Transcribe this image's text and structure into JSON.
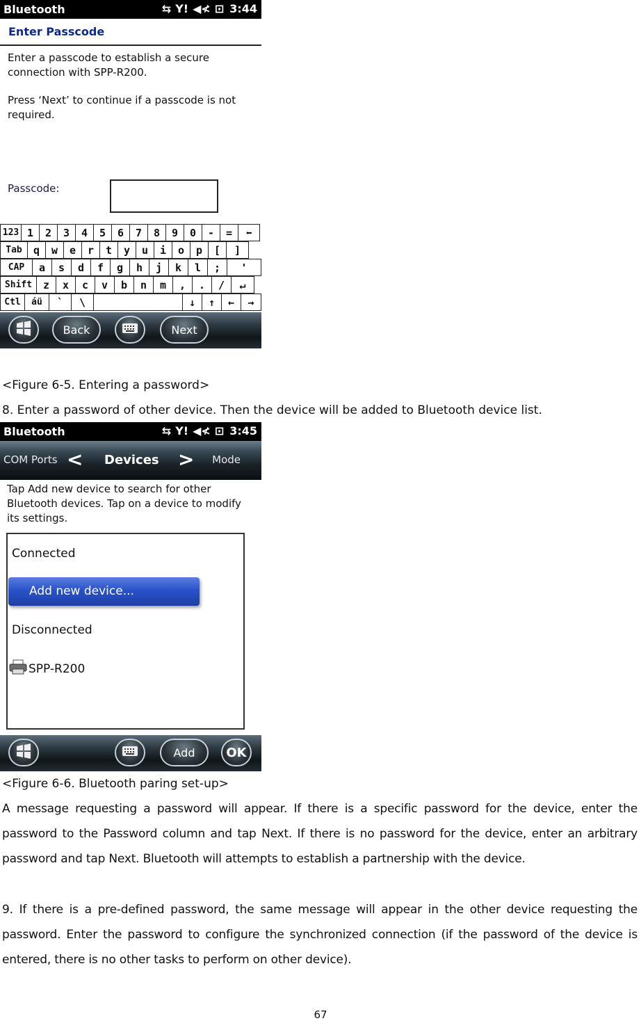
{
  "figure1": {
    "statusbar": {
      "title": "Bluetooth",
      "time": "3:44",
      "icons": [
        "connectivity-arrows-icon",
        "signal-antenna-icon",
        "speaker-muted-icon",
        "power-plug-icon"
      ]
    },
    "header": "Enter Passcode",
    "message1": "Enter a passcode to establish a secure connection with SPP-R200.",
    "message2": "Press ‘Next’ to continue if a passcode is not required.",
    "passcode_label": "Passcode:",
    "passcode_value": "",
    "keyboard": {
      "rows": [
        [
          "123",
          "1",
          "2",
          "3",
          "4",
          "5",
          "6",
          "7",
          "8",
          "9",
          "0",
          "-",
          "=",
          "⬅"
        ],
        [
          "Tab",
          "q",
          "w",
          "e",
          "r",
          "t",
          "y",
          "u",
          "i",
          "o",
          "p",
          "[",
          "]"
        ],
        [
          "CAP",
          "a",
          "s",
          "d",
          "f",
          "g",
          "h",
          "j",
          "k",
          "l",
          ";",
          "'"
        ],
        [
          "Shift",
          "z",
          "x",
          "c",
          "v",
          "b",
          "n",
          "m",
          ",",
          ".",
          "/",
          "↵"
        ],
        [
          "Ctl",
          "áü",
          "`",
          "\\",
          " ",
          "↓",
          "↑",
          "←",
          "→"
        ]
      ]
    },
    "softkeys": {
      "start": "start-icon",
      "left": "Back",
      "keyboard": "keyboard-icon",
      "right": "Next"
    }
  },
  "caption1": "<Figure 6-5. Entering a password>",
  "step8": "8. Enter a password of other device. Then the device will be added to Bluetooth device list.",
  "figure2": {
    "statusbar": {
      "title": "Bluetooth",
      "time": "3:45"
    },
    "tabs": {
      "prev": "COM Ports",
      "current": "Devices",
      "next": "Mode"
    },
    "instructions": "Tap Add new device to search for other Bluetooth devices. Tap on a device to modify its settings.",
    "list": {
      "connected_label": "Connected",
      "add_button": "Add new device...",
      "disconnected_label": "Disconnected",
      "devices": [
        {
          "name": "SPP-R200",
          "icon": "printer-icon"
        }
      ]
    },
    "softkeys": {
      "start": "start-icon",
      "keyboard": "keyboard-icon",
      "add": "Add",
      "ok": "OK"
    }
  },
  "caption2": "<Figure 6-6. Bluetooth paring set-up>",
  "paragraph1": "A message requesting a password will appear. If there is a specific password for the device, enter the password to the Password column and tap Next. If there is no password for the device, enter an arbitrary password and tap Next. Bluetooth will attempts to establish a partnership with the device.",
  "paragraph2": "9. If there is a pre-defined password, the same message will appear in the other device requesting the password. Enter the password to configure the synchronized connection (if the password of the device is entered, there is no other tasks to perform on other device).",
  "page_number": "67",
  "colors": {
    "header_blue": "#0f2a8c",
    "add_button_blue": "#2a52c8",
    "statusbar_black": "#000000"
  }
}
